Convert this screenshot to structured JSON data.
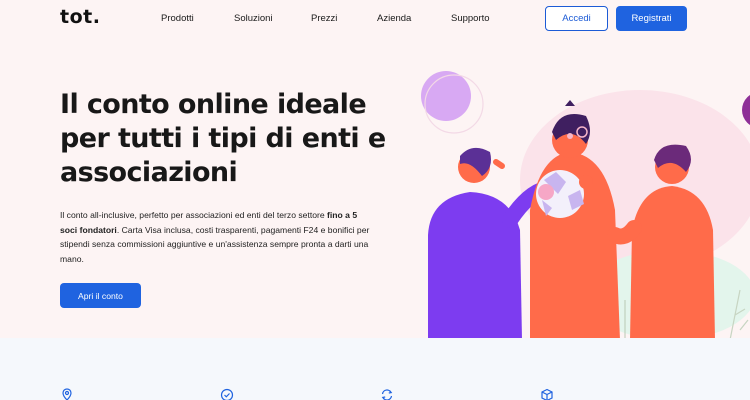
{
  "header": {
    "logo": "tot.",
    "nav": [
      "Prodotti",
      "Soluzioni",
      "Prezzi",
      "Azienda",
      "Supporto"
    ],
    "login_label": "Accedi",
    "signup_label": "Registrati"
  },
  "hero": {
    "title": "Il conto online ideale per tutti i tipi di enti e associazioni",
    "desc_part1": "Il conto all-inclusive, perfetto per associazioni ed enti del terzo settore ",
    "desc_bold": "fino a 5 soci fondatori",
    "desc_part2": ". Carta Visa inclusa, costi trasparenti, pagamenti F24 e bonifici per stipendi senza commissioni aggiuntive e un'assistenza sempre pronta a darti una mano.",
    "cta_label": "Apri il conto"
  },
  "features": {
    "icons": [
      "location-pin-icon",
      "check-circle-icon",
      "refresh-icon",
      "box-icon"
    ]
  },
  "colors": {
    "primary": "#1f63e0",
    "background": "#fdf4f4",
    "purple": "#7d3cf0",
    "orange": "#ff6b4a"
  }
}
